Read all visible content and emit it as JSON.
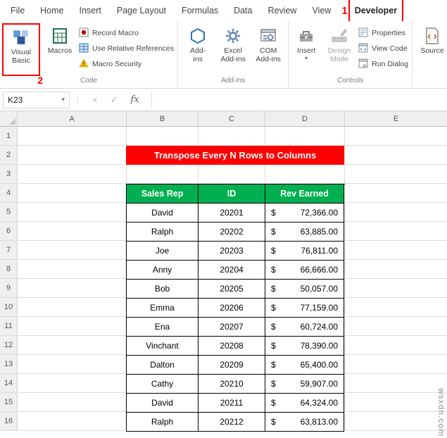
{
  "tabs": [
    "File",
    "Home",
    "Insert",
    "Page Layout",
    "Formulas",
    "Data",
    "Review",
    "View"
  ],
  "developer_tab": "Developer",
  "annotation_1": "1",
  "annotation_2": "2",
  "ribbon": {
    "code": {
      "label": "Code",
      "visual_basic_l1": "Visual",
      "visual_basic_l2": "Basic",
      "macros": "Macros",
      "record_macro": "Record Macro",
      "use_relative_references": "Use Relative References",
      "macro_security": "Macro Security"
    },
    "addins": {
      "label": "Add-ins",
      "add_ins_l1": "Add-",
      "add_ins_l2": "ins",
      "excel_l1": "Excel",
      "excel_l2": "Add-ins",
      "com_l1": "COM",
      "com_l2": "Add-ins"
    },
    "controls": {
      "label": "Controls",
      "insert": "Insert",
      "insert_arrow": "▾",
      "design_l1": "Design",
      "design_l2": "Mode",
      "properties": "Properties",
      "view_code": "View Code",
      "run_dialog": "Run Dialog"
    },
    "xml": {
      "source": "Source"
    }
  },
  "formula_bar": {
    "name_box": "K23",
    "name_box_arrow": "▾",
    "cancel": "×",
    "enter": "✓",
    "fx": "fx",
    "separator": "⋮"
  },
  "sheet": {
    "columns": [
      "A",
      "B",
      "C",
      "D",
      "E"
    ],
    "row_numbers": [
      "1",
      "2",
      "3",
      "4",
      "5",
      "6",
      "7",
      "8",
      "9",
      "10",
      "11",
      "12",
      "13",
      "14",
      "15",
      "16"
    ],
    "banner": "Transpose Every N Rows to Columns",
    "table": {
      "headers": [
        "Sales Rep",
        "ID",
        "Rev Earned"
      ],
      "currency": "$",
      "rows": [
        {
          "rep": "David",
          "id": "20201",
          "rev": "72,366.00"
        },
        {
          "rep": "Ralph",
          "id": "20202",
          "rev": "63,885.00"
        },
        {
          "rep": "Joe",
          "id": "20203",
          "rev": "76,811.00"
        },
        {
          "rep": "Anny",
          "id": "20204",
          "rev": "66,666.00"
        },
        {
          "rep": "Bob",
          "id": "20205",
          "rev": "50,057.00"
        },
        {
          "rep": "Emma",
          "id": "20206",
          "rev": "77,159.00"
        },
        {
          "rep": "Ena",
          "id": "20207",
          "rev": "60,724.00"
        },
        {
          "rep": "Vinchant",
          "id": "20208",
          "rev": "78,390.00"
        },
        {
          "rep": "Dalton",
          "id": "20209",
          "rev": "65,400.00"
        },
        {
          "rep": "Cathy",
          "id": "20210",
          "rev": "59,907.00"
        },
        {
          "rep": "David",
          "id": "20211",
          "rev": "64,324.00"
        },
        {
          "rep": "Ralph",
          "id": "20212",
          "rev": "63,813.00"
        }
      ]
    }
  },
  "watermark": "wsxdn.com",
  "colors": {
    "banner_red": "#ff0000",
    "header_green": "#00b050",
    "annotation_red": "#ff0000"
  },
  "icons": {
    "visual_basic": "vb-blocks-icon",
    "macros": "macro-sheet-icon",
    "record_macro": "record-macro-icon",
    "use_relative_references": "relative-references-icon",
    "macro_security": "warning-triangle-icon",
    "add_ins": "hexagon-icon",
    "excel_add_ins": "gear-icon",
    "com_add_ins": "window-gear-icon",
    "insert": "toolbox-icon",
    "design_mode": "ruler-pencil-icon",
    "properties": "properties-list-icon",
    "view_code": "code-window-icon",
    "run_dialog": "dialog-window-icon",
    "source": "xml-doc-icon"
  }
}
